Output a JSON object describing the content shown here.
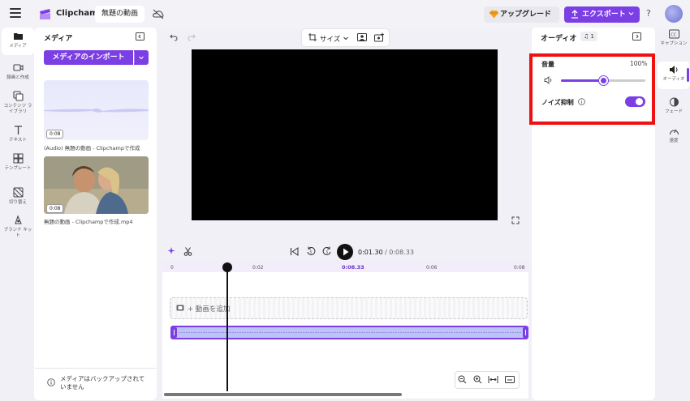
{
  "app": {
    "name": "Clipchamp",
    "project_title": "無題の動画"
  },
  "header": {
    "upgrade_label": "アップグレード",
    "export_label": "エクスポート",
    "help_label": "?"
  },
  "left_rail": [
    {
      "label": "メディア",
      "icon": "folder-icon"
    },
    {
      "label": "録画と作成",
      "icon": "record-icon"
    },
    {
      "label": "コンテンツ ライブラリ",
      "icon": "library-icon"
    },
    {
      "label": "テキスト",
      "icon": "text-icon"
    },
    {
      "label": "テンプレート",
      "icon": "template-icon"
    },
    {
      "label": "切り替え",
      "icon": "transition-icon"
    },
    {
      "label": "ブランド キット",
      "icon": "brand-kit-icon"
    }
  ],
  "media_panel": {
    "title": "メディア",
    "import_label": "メディアのインポート",
    "items": [
      {
        "type": "audio",
        "duration": "0:08",
        "label": "(Audio) 無題の動画 - Clipchampで作成"
      },
      {
        "type": "video",
        "duration": "0:08",
        "label": "無題の動画 - Clipchampで作成.mp4"
      }
    ],
    "backup_notice": "メディアはバックアップされていません"
  },
  "canvas_toolbar": {
    "size_label": "サイズ"
  },
  "playback": {
    "current_time": "0:01.30",
    "total_time": "/ 0:08.33"
  },
  "timeline": {
    "ruler_ticks": [
      "0",
      "0:02",
      "0:06",
      "0:08"
    ],
    "marker_time": "0:08.33",
    "add_video_label": "+ 動画を追加"
  },
  "properties": {
    "title": "オーディオ",
    "audio_count": "1",
    "volume_label": "音量",
    "volume_value": "100%",
    "volume_fraction": 0.5,
    "noise_label": "ノイズ抑制",
    "noise_enabled": true
  },
  "right_rail": [
    {
      "label": "キャプション",
      "icon": "captions-icon"
    },
    {
      "label": "オーディオ",
      "icon": "speaker-icon"
    },
    {
      "label": "フェード",
      "icon": "fade-icon"
    },
    {
      "label": "速度",
      "icon": "speed-icon"
    }
  ],
  "colors": {
    "accent": "#7b3fe4",
    "highlight": "#ee1111",
    "canvas_bg": "#000000"
  }
}
